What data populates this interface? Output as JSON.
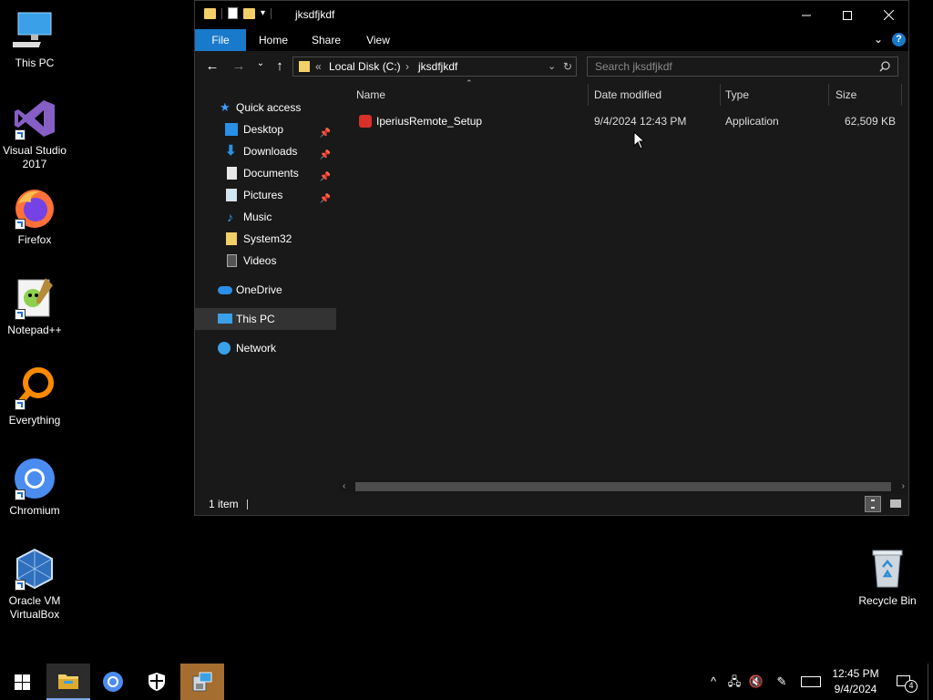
{
  "desktop": {
    "icons": [
      {
        "label": "This PC"
      },
      {
        "label": "Visual Studio 2017"
      },
      {
        "label": "Firefox"
      },
      {
        "label": "Notepad++"
      },
      {
        "label": "Everything"
      },
      {
        "label": "Chromium"
      },
      {
        "label": "Oracle VM VirtualBox"
      },
      {
        "label": "Recycle Bin"
      }
    ]
  },
  "explorer": {
    "title": "jksdfjkdf",
    "ribbon_tabs": [
      "File",
      "Home",
      "Share",
      "View"
    ],
    "address": {
      "chevron": "«",
      "crumbs": [
        "Local Disk (C:)",
        "jksdfjkdf"
      ],
      "separator": "›"
    },
    "search": {
      "placeholder": "Search jksdfjkdf"
    },
    "nav": [
      {
        "label": "Quick access"
      },
      {
        "label": "Desktop",
        "pinned": true
      },
      {
        "label": "Downloads",
        "pinned": true
      },
      {
        "label": "Documents",
        "pinned": true
      },
      {
        "label": "Pictures",
        "pinned": true
      },
      {
        "label": "Music"
      },
      {
        "label": "System32"
      },
      {
        "label": "Videos"
      },
      {
        "label": "OneDrive"
      },
      {
        "label": "This PC",
        "selected": true
      },
      {
        "label": "Network"
      }
    ],
    "columns": [
      "Name",
      "Date modified",
      "Type",
      "Size"
    ],
    "files": [
      {
        "name": "IperiusRemote_Setup",
        "date": "9/4/2024 12:43 PM",
        "type": "Application",
        "size": "62,509 KB"
      }
    ],
    "status": "1 item"
  },
  "taskbar": {
    "clock_time": "12:45 PM",
    "clock_date": "9/4/2024",
    "notification_count": "4"
  },
  "colors": {
    "accent": "#1979ca",
    "folder": "#f3cf68",
    "window_bg": "#191919"
  }
}
